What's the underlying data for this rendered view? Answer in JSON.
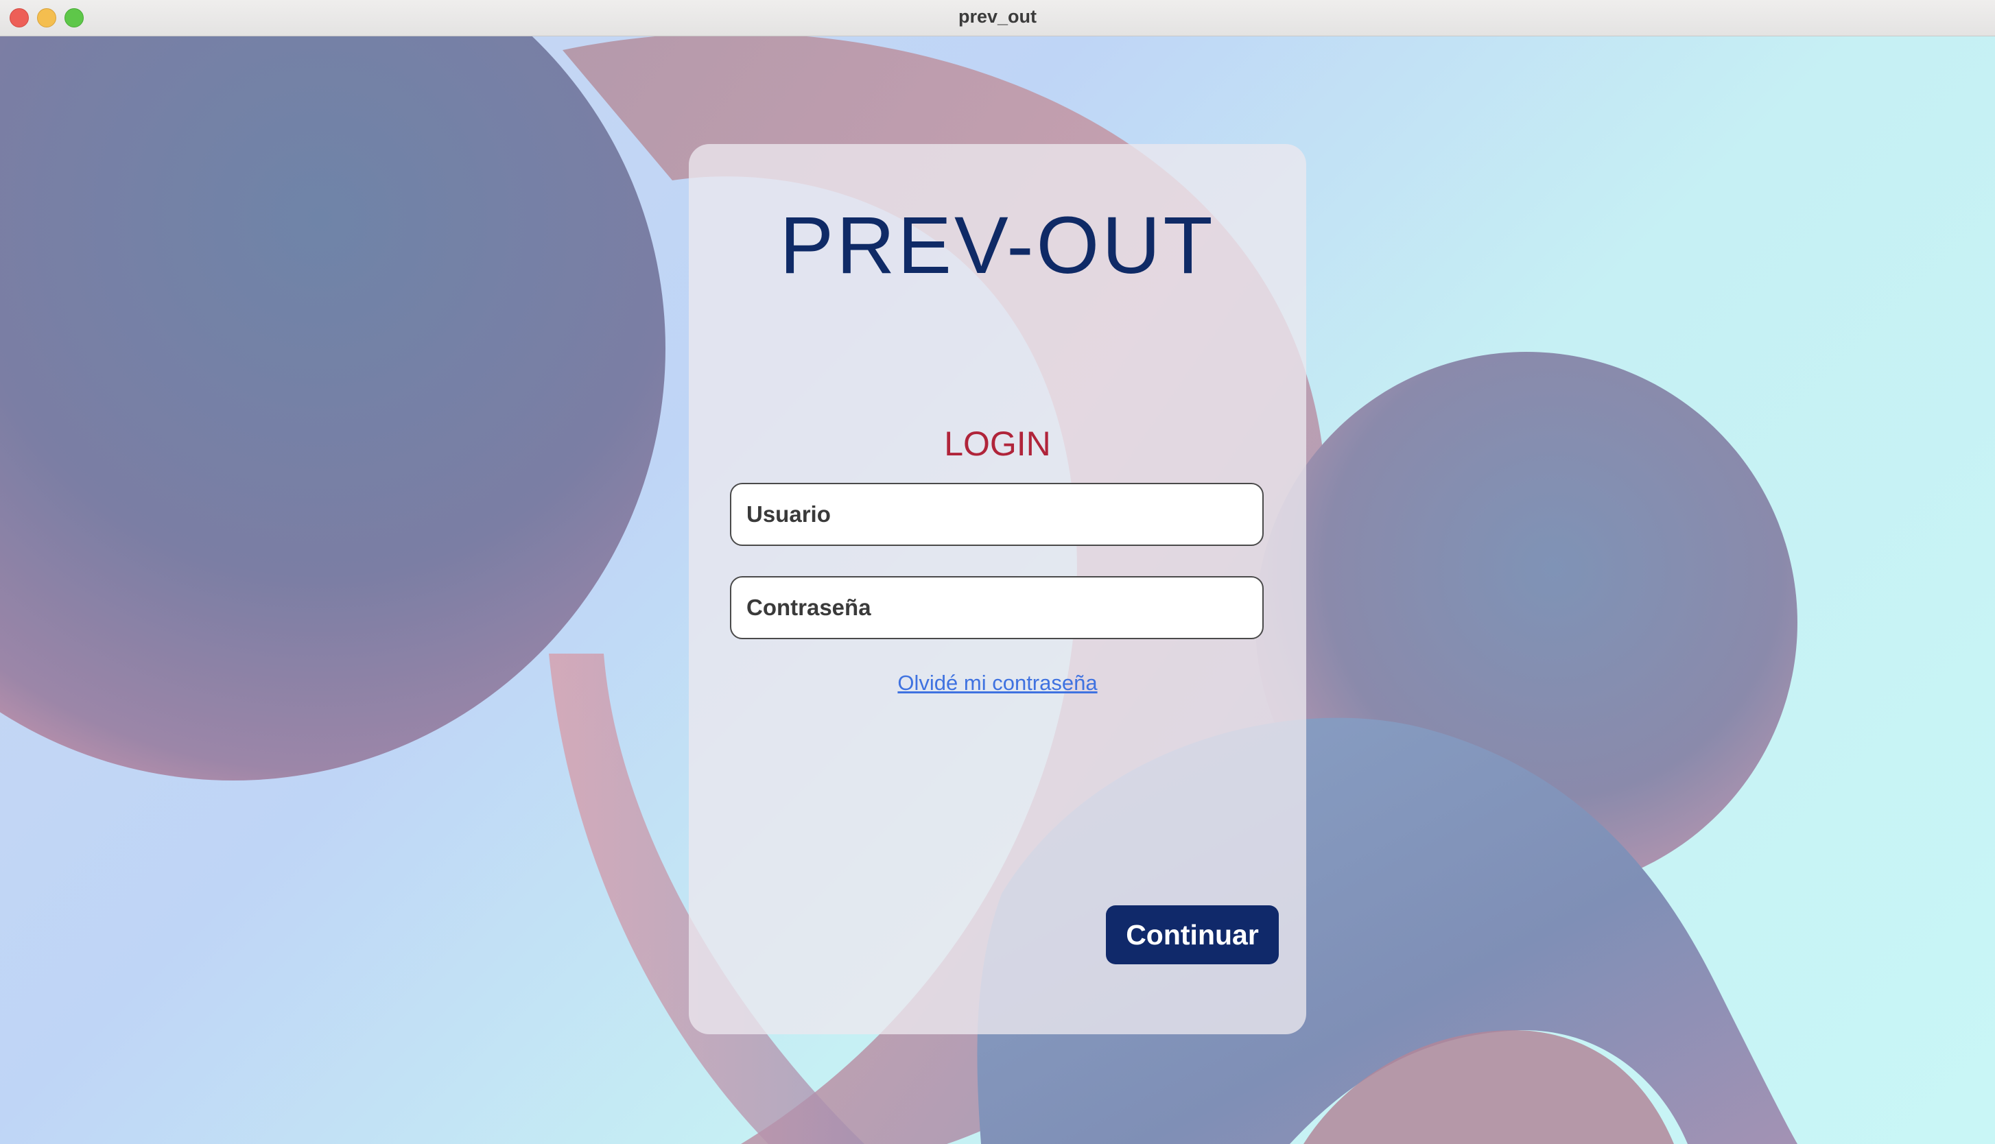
{
  "window": {
    "title": "prev_out"
  },
  "card": {
    "brand": "PREV-OUT",
    "heading": "LOGIN",
    "username_placeholder": "Usuario",
    "password_placeholder": "Contraseña",
    "forgot_link": "Olvidé mi contraseña",
    "continue_label": "Continuar"
  },
  "colors": {
    "brand": "#0f2a66",
    "heading": "#b0243a",
    "link": "#3f72e0",
    "button": "#10296a"
  }
}
